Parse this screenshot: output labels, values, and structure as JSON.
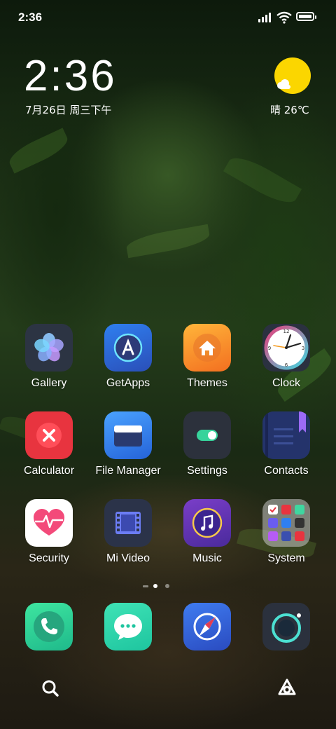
{
  "status_bar": {
    "time": "2:36"
  },
  "clock_widget": {
    "time": "2:36",
    "date": "7月26日 周三下午"
  },
  "weather": {
    "condition": "晴",
    "temperature": "26℃",
    "text": "晴 26℃"
  },
  "apps": [
    {
      "label": "Gallery"
    },
    {
      "label": "GetApps"
    },
    {
      "label": "Themes"
    },
    {
      "label": "Clock"
    },
    {
      "label": "Calculator"
    },
    {
      "label": "File Manager"
    },
    {
      "label": "Settings"
    },
    {
      "label": "Contacts"
    },
    {
      "label": "Security"
    },
    {
      "label": "Mi Video"
    },
    {
      "label": "Music"
    },
    {
      "label": "System"
    }
  ],
  "page_indicator": {
    "pages": 2,
    "current": 2
  },
  "dock": [
    {
      "name": "phone",
      "icon": "phone-icon"
    },
    {
      "name": "messages",
      "icon": "message-icon"
    },
    {
      "name": "browser",
      "icon": "compass-icon"
    },
    {
      "name": "camera",
      "icon": "camera-icon"
    }
  ],
  "bottom_bar": {
    "left_icon": "search-icon",
    "right_icon": "app-vault-icon"
  },
  "colors": {
    "sun": "#fbd600",
    "calculator": "#e8343f",
    "themes": "#f8892a"
  }
}
